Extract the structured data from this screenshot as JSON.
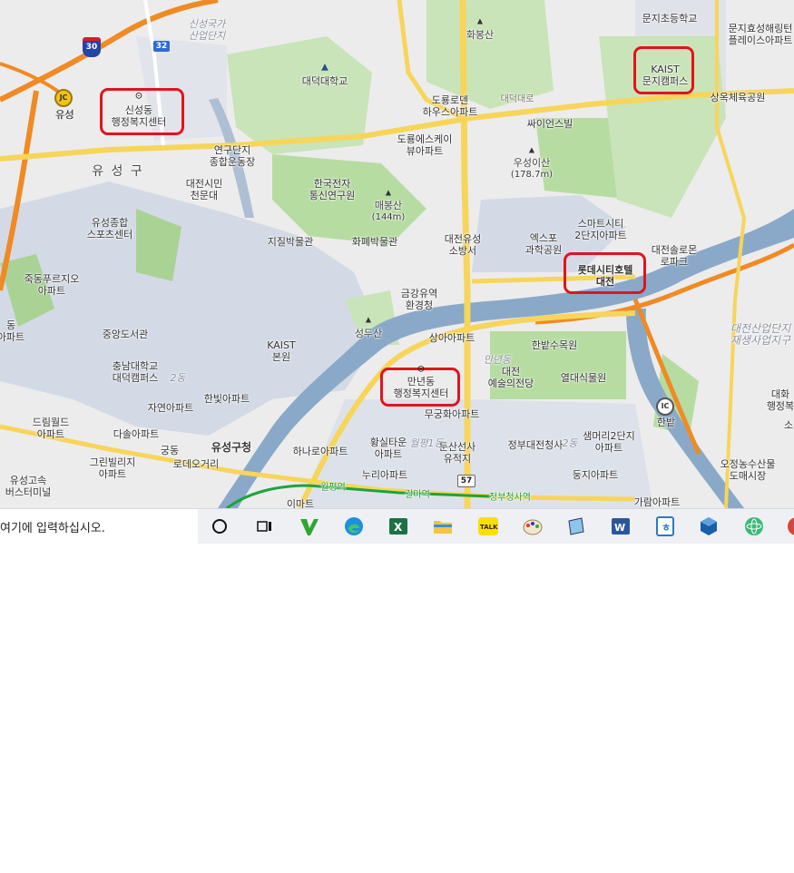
{
  "map": {
    "districts": {
      "yuseong_gu": "유 성 구"
    },
    "areas": {
      "sinseong_industrial": "신성국가\n산업단지",
      "daejeon_industrial": "대전산업단지\n재생사업지구",
      "sinseongdong_faint": "신성동",
      "dong2_faint": "2동",
      "mannyeon_faint": "만년동",
      "wolpyeong_faint": "월평1동",
      "dong2_right_faint": "2동",
      "seonghae_faint": "신성동"
    },
    "labels": {
      "daedeok_univ": "대덕대학교",
      "hwabongsan": "화봉산",
      "doryong_lotte": "도룡로덴\n하우스아파트",
      "science_building": "싸이언스빌",
      "doryong_sk": "도룡에스케이\n뷰아파트",
      "useongisan": "우성이산",
      "useongisan_height": "(178.7m)",
      "munji_elementary": "문지초등학교",
      "munji_hyoseong": "문지효성해링턴\n플레이스아파트",
      "sangok_gym": "상옥체육공원",
      "yuseong_ic": "유성",
      "research_sports": "연구단지\n종합운동장",
      "daejeon_citizen": "대전시민\n천문대",
      "etri": "한국전자\n통신연구원",
      "maebongsan": "매봉산",
      "maebongsan_height": "(144m)",
      "yuseong_fire": "대전유성\n소방서",
      "expo_science": "엑스포\n과학공원",
      "smart_city": "스마트시티\n2단지아파트",
      "daejeon_solrong": "대전솔로몬\n로파크",
      "yuseong_sports": "유성종합\n스포츠센터",
      "geology_museum": "지질박물관",
      "currency_museum": "화폐박물관",
      "jukdong_apt": "죽동푸르지오\n아파트",
      "geumgang_env": "금강유역\n환경청",
      "jungang_library": "중앙도서관",
      "cnu_daedeok": "충남대학교\n대덕캠퍼스",
      "kaist_main": "KAIST\n본원",
      "seongdusan": "성두산",
      "sanga_apt": "상아아파트",
      "hanbat_arboretum": "한밭수목원",
      "daejeon_arts": "대전\n예술의전당",
      "yeoldae_garden": "열대식물원",
      "hanbit_apt": "한빛아파트",
      "jayeon_apt": "자연아파트",
      "dreamworld_apt": "드림월드\n아파트",
      "dasol_apt": "다솔아파트",
      "gungdong": "궁동",
      "yuseong_office": "유성구청",
      "rodeo": "로데오거리",
      "hana_apt": "하나로아파트",
      "hwangsil_apt": "황실타운\n아파트",
      "dunsan_ruins": "둔산선사\n유적지",
      "gov_complex": "정부대전청사",
      "saemmeori_apt": "샘머리2단지\n아파트",
      "mugunghwa_apt": "무궁화아파트",
      "greenville_apt": "그린빌리지\n아파트",
      "nuri_apt": "누리아파트",
      "dunji_apt": "둥지아파트",
      "yuseong_terminal": "유성고속\n버스터미널",
      "emart": "이마트",
      "garam_apt": "가람아파트",
      "ojeong_market": "오정농수산물\n도매시장",
      "hanbat_ic": "한밭",
      "daehwa_office": "대화\n행정복",
      "yuseong_left": "유성",
      "dong_left": "동\n아파트",
      "daedeok_road": "대덕대로",
      "so_right": "소"
    },
    "highlights": {
      "sinseong_center": "신성동\n행정복지센터",
      "kaist_munji": "KAIST\n문지캠퍼스",
      "lotte_city_hotel": "롯데시티호텔\n대전",
      "mannyeon_center": "만년동\n행정복지센터"
    },
    "stations": {
      "wolpyeong": "월평역",
      "galma": "갈마역",
      "government": "정부청사역"
    },
    "route_shields": {
      "route_30": "30",
      "route_32": "32",
      "route_57": "57",
      "jc": "JC",
      "ic": "IC"
    },
    "colors": {
      "expressway": "#f08a24",
      "arterial": "#f7d55a",
      "river": "#7f9fc0",
      "park": "#b7dca2",
      "urban": "#d3dae6",
      "subway": "#1da33d",
      "highlight": "#e0141e"
    }
  },
  "taskbar": {
    "search_placeholder": "여기에 입력하십시오.",
    "icons": [
      "cortana-circle-icon",
      "task-view-icon",
      "vim-icon",
      "edge-browser-icon",
      "excel-icon",
      "file-explorer-icon",
      "kakaotalk-icon",
      "paint-icon",
      "notepad-icon",
      "word-icon",
      "hanword-icon",
      "virtualbox-icon",
      "atom-icon",
      "chrome-icon"
    ],
    "kakaotalk_label": "TALK"
  }
}
